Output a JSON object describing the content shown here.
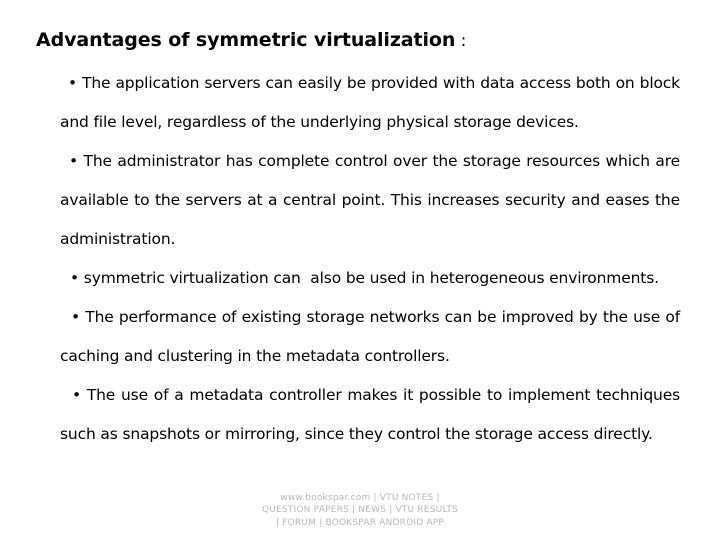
{
  "slide": {
    "title": "Advantages of symmetric virtualization",
    "title_colon": ":",
    "bullet_marker": "•",
    "bullets": [
      {
        "text": "The application servers can easily be provided with data access both on block and file level, regardless of the underlying physical storage devices."
      },
      {
        "text": "The administrator has complete control over the storage resources which are available to the servers at a central point. This increases security and eases the administration."
      },
      {
        "text": "symmetric virtualization can  also be used in heterogeneous environments."
      },
      {
        "text": "The performance of existing storage networks can be improved by the use of caching and clustering in the metadata controllers."
      },
      {
        "text": "The use of a metadata controller makes it possible to implement techniques such as snapshots or mirroring, since they control the storage access directly."
      }
    ]
  },
  "footer": {
    "line1": "www.bookspar.com | VTU NOTES |",
    "line2": "QUESTION PAPERS | NEWS | VTU RESULTS",
    "line3": "| FORUM | BOOKSPAR ANDROID APP",
    "color": "#b8b8b8"
  },
  "colors": {
    "background": "#ffffff",
    "text": "#000000",
    "footer_text": "#b8b8b8"
  }
}
